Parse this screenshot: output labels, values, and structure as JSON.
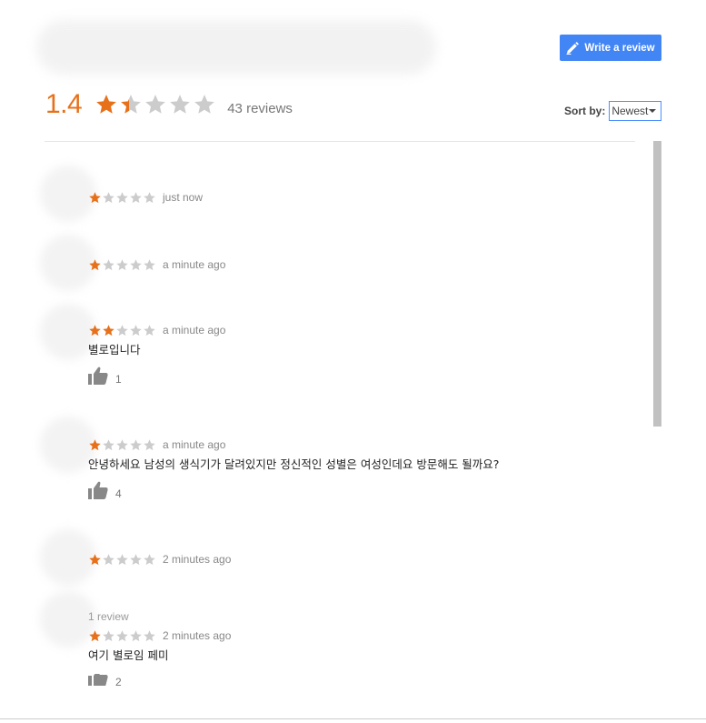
{
  "header": {
    "write_review_label": "Write a review",
    "pencil_icon": "pencil-icon"
  },
  "summary": {
    "rating": "1.4",
    "rating_value": 1.4,
    "review_count": "43 reviews"
  },
  "sort": {
    "label": "Sort by:",
    "selected": "Newest"
  },
  "colors": {
    "accent": "#4285f4",
    "star_filled": "#e7711b",
    "star_empty": "#cccccc",
    "scroll_thumb": "#c1c1c1"
  },
  "reviews": [
    {
      "stars": 1,
      "time": "just now",
      "meta": "",
      "text": "",
      "likes": ""
    },
    {
      "stars": 1,
      "time": "a minute ago",
      "meta": "",
      "text": "",
      "likes": ""
    },
    {
      "stars": 2,
      "time": "a minute ago",
      "meta": "",
      "text": "별로입니다",
      "likes": "1"
    },
    {
      "stars": 1,
      "time": "a minute ago",
      "meta": "",
      "text": "안녕하세요 남성의 생식기가 달려있지만 정신적인 성별은 여성인데요 방문해도 될까요?",
      "likes": "4"
    },
    {
      "stars": 1,
      "time": "2 minutes ago",
      "meta": "",
      "text": "",
      "likes": ""
    },
    {
      "stars": 1,
      "time": "2 minutes ago",
      "meta": "1 review",
      "text": "여기 별로임 페미",
      "likes": "2"
    }
  ]
}
